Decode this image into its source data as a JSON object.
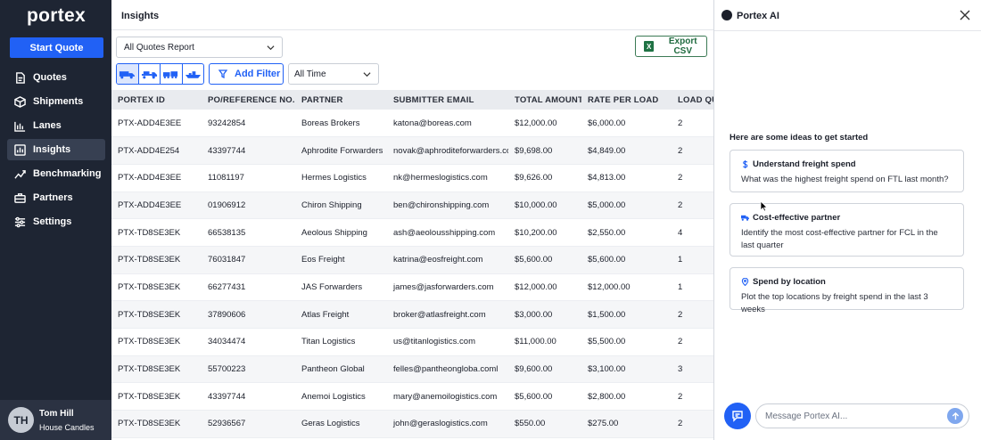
{
  "sidebar": {
    "logo": "portex",
    "start_quote": "Start Quote",
    "items": [
      {
        "label": "Quotes",
        "icon": "quote-doc-icon"
      },
      {
        "label": "Shipments",
        "icon": "box-icon"
      },
      {
        "label": "Lanes",
        "icon": "lanes-icon"
      },
      {
        "label": "Insights",
        "icon": "chart-icon",
        "active": true
      },
      {
        "label": "Benchmarking",
        "icon": "trend-icon"
      },
      {
        "label": "Partners",
        "icon": "briefcase-icon"
      },
      {
        "label": "Settings",
        "icon": "sliders-icon"
      }
    ],
    "user": {
      "initials": "TH",
      "name": "Tom Hill",
      "company": "House Candles"
    }
  },
  "main": {
    "title": "Insights",
    "report_select": "All Quotes Report",
    "export_label": "Export CSV",
    "add_filter": "Add Filter",
    "time_select": "All Time",
    "modes": [
      "truck-icon",
      "flatbed-truck-icon",
      "train-icon",
      "ship-icon"
    ],
    "table": {
      "headers": [
        "PORTEX ID",
        "PO/REFERENCE NO.",
        "PARTNER",
        "SUBMITTER EMAIL",
        "TOTAL AMOUNT",
        "RATE PER LOAD",
        "LOAD QU"
      ],
      "rows": [
        [
          "PTX-ADD4E3EE",
          "93242854",
          "Boreas Brokers",
          "katona@boreas.com",
          "$12,000.00",
          "$6,000.00",
          "2"
        ],
        [
          "PTX-ADD4E254",
          "43397744",
          "Aphrodite Forwarders",
          "novak@aphroditeforwarders.com",
          "$9,698.00",
          "$4,849.00",
          "2"
        ],
        [
          "PTX-ADD4E3EE",
          "11081197",
          "Hermes Logistics",
          "nk@hermeslogistics.com",
          "$9,626.00",
          "$4,813.00",
          "2"
        ],
        [
          "PTX-ADD4E3EE",
          "01906912",
          "Chiron Shipping",
          "ben@chironshipping.com",
          "$10,000.00",
          "$5,000.00",
          "2"
        ],
        [
          "PTX-TD8SE3EK",
          "66538135",
          "Aeolous Shipping",
          "ash@aeolousshipping.com",
          "$10,200.00",
          "$2,550.00",
          "4"
        ],
        [
          "PTX-TD8SE3EK",
          "76031847",
          "Eos Freight",
          "katrina@eosfreight.com",
          "$5,600.00",
          "$5,600.00",
          "1"
        ],
        [
          "PTX-TD8SE3EK",
          "66277431",
          "JAS Forwarders",
          "james@jasforwarders.com",
          "$12,000.00",
          "$12,000.00",
          "1"
        ],
        [
          "PTX-TD8SE3EK",
          "37890606",
          "Atlas Freight",
          "broker@atlasfreight.com",
          "$3,000.00",
          "$1,500.00",
          "2"
        ],
        [
          "PTX-TD8SE3EK",
          "34034474",
          "Titan Logistics",
          "us@titanlogistics.com",
          "$11,000.00",
          "$5,500.00",
          "2"
        ],
        [
          "PTX-TD8SE3EK",
          "55700223",
          "Pantheon Global",
          "felles@pantheongloba.coml",
          "$9,600.00",
          "$3,100.00",
          "3"
        ],
        [
          "PTX-TD8SE3EK",
          "43397744",
          "Anemoi Logistics",
          "mary@anemoilogistics.com",
          "$5,600.00",
          "$2,800.00",
          "2"
        ],
        [
          "PTX-TD8SE3EK",
          "52936567",
          "Geras Logistics",
          "john@geraslogistics.com",
          "$550.00",
          "$275.00",
          "2"
        ]
      ]
    }
  },
  "ai_panel": {
    "title": "Portex AI",
    "ideas_title": "Here are some ideas to get started",
    "cards": [
      {
        "icon": "dollar-icon",
        "title": "Understand freight spend",
        "body": "What was the highest freight spend on FTL last month?"
      },
      {
        "icon": "truck-icon",
        "title": "Cost-effective partner",
        "body": "Identify the most cost-effective partner for FCL in the last quarter"
      },
      {
        "icon": "location-pin-icon",
        "title": "Spend by location",
        "body": "Plot the top locations by freight spend in the last 3 weeks"
      }
    ],
    "input_placeholder": "Message Portex AI..."
  },
  "colors": {
    "brand": "#2161f5",
    "sidebar_bg": "#1e2533",
    "excel_green": "#1f7244"
  }
}
